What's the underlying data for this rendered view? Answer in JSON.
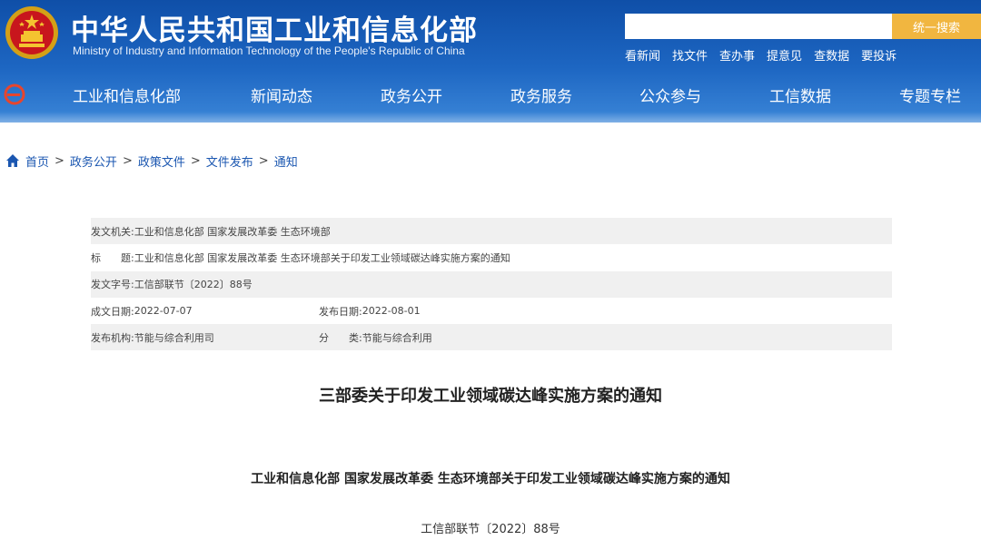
{
  "header": {
    "title": "中华人民共和国工业和信息化部",
    "subtitle": "Ministry of Industry and Information Technology of the People's Republic of China",
    "search_placeholder": "",
    "search_button": "统一搜索",
    "quick_links": [
      "看新闻",
      "找文件",
      "查办事",
      "提意见",
      "查数据",
      "要投诉"
    ],
    "colors": {
      "primary": "#1d66c2",
      "accent": "#f1b640"
    }
  },
  "nav": {
    "items": [
      "工业和信息化部",
      "新闻动态",
      "政务公开",
      "政务服务",
      "公众参与",
      "工信数据",
      "专题专栏"
    ]
  },
  "breadcrumb": {
    "items": [
      "首页",
      "政务公开",
      "政策文件",
      "文件发布",
      "通知"
    ],
    "separator": ">"
  },
  "meta": {
    "issuer_label": "发文机关:",
    "issuer_value": "工业和信息化部 国家发展改革委 生态环境部",
    "title_label": "标　　题:",
    "title_value": "工业和信息化部 国家发展改革委 生态环境部关于印发工业领域碳达峰实施方案的通知",
    "doc_no_label": "发文字号:",
    "doc_no_value": "工信部联节〔2022〕88号",
    "created_label": "成文日期:",
    "created_value": "2022-07-07",
    "published_label": "发布日期:",
    "published_value": "2022-08-01",
    "agency_label": "发布机构:",
    "agency_value": "节能与综合利用司",
    "category_label": "分　　类:",
    "category_value": "节能与综合利用"
  },
  "document": {
    "title": "三部委关于印发工业领域碳达峰实施方案的通知",
    "subtitle": "工业和信息化部 国家发展改革委 生态环境部关于印发工业领域碳达峰实施方案的通知",
    "number": "工信部联节〔2022〕88号"
  },
  "icons": {
    "emblem": "national-emblem-icon",
    "nav_logo": "e-logo-icon",
    "home": "home-icon"
  }
}
